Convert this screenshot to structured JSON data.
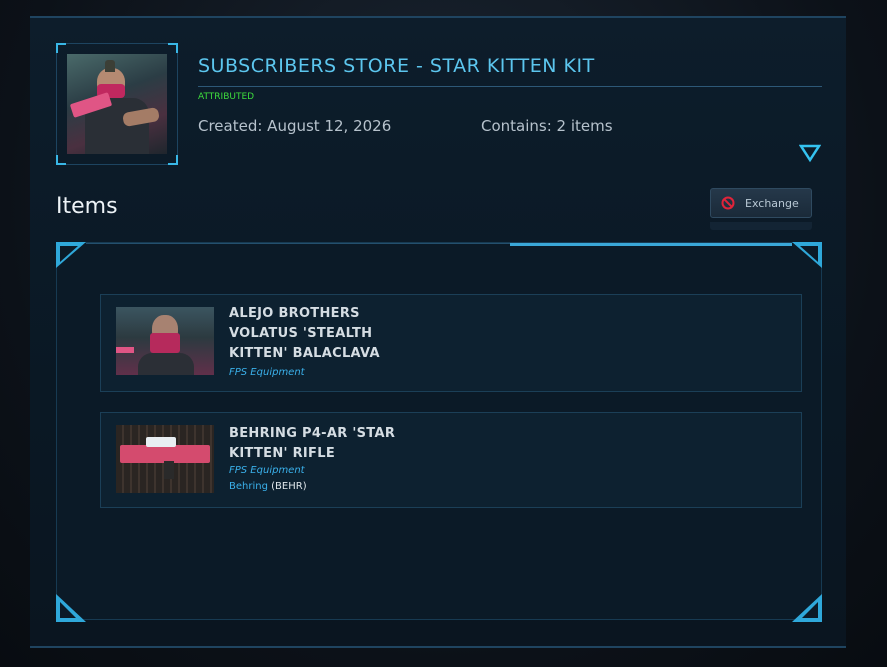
{
  "pledge": {
    "title": "SUBSCRIBERS STORE - STAR KITTEN KIT",
    "status": "ATTRIBUTED",
    "created": "Created: August 12, 2026",
    "contains": "Contains: 2 items"
  },
  "items_section": {
    "title": "Items",
    "exchange_label": "Exchange"
  },
  "items": [
    {
      "name": "ALEJO BROTHERS VOLATUS 'STEALTH KITTEN' BALACLAVA",
      "category": "FPS Equipment"
    },
    {
      "name": "BEHRING P4-AR 'STAR KITTEN' RIFLE",
      "category": "FPS Equipment",
      "manufacturer": "Behring",
      "manufacturer_code": "BEHR"
    }
  ],
  "icons": {
    "expand": "chevron-down-triangle-icon",
    "exchange": "no-entry-icon"
  },
  "colors": {
    "accent": "#3ab0ea",
    "title": "#5cc6ee",
    "status_green": "#3ddc3d",
    "no_entry_red": "#e0243a"
  }
}
